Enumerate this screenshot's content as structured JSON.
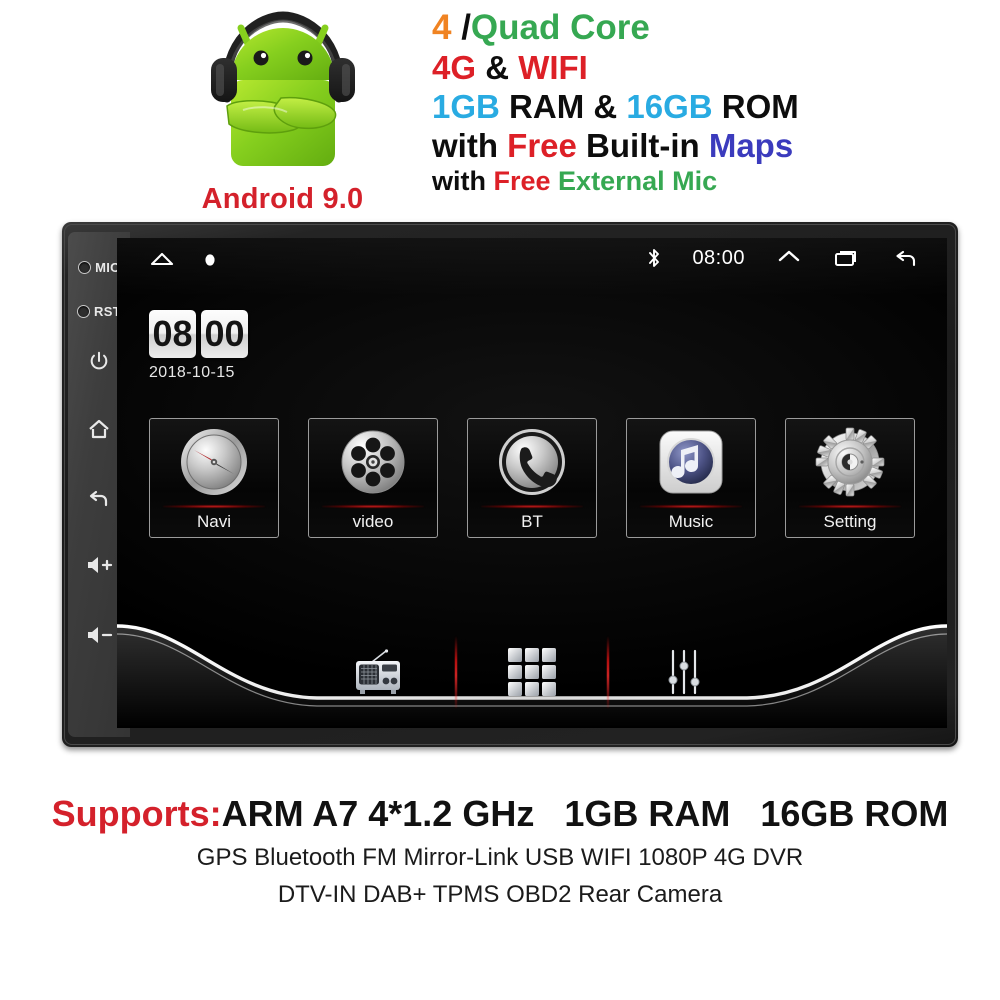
{
  "header": {
    "android": {
      "logo_icon": "android-robot-with-headphones-icon",
      "label": "Android 9.0",
      "label_color": "#d4212b"
    },
    "spec_lines": [
      {
        "id": "cpu",
        "parts": [
          {
            "text": "4",
            "color": "#f08322"
          },
          {
            "text": " /",
            "color": "#0d0d0d"
          },
          {
            "text": "Quad Core",
            "color": "#36a852"
          }
        ]
      },
      {
        "id": "connectivity",
        "parts": [
          {
            "text": "4G",
            "color": "#dd2027"
          },
          {
            "text": " & ",
            "color": "#0d0d0d"
          },
          {
            "text": "WIFI",
            "color": "#dd2027"
          }
        ]
      },
      {
        "id": "memory",
        "parts": [
          {
            "text": "1GB",
            "color": "#29abe2"
          },
          {
            "text": " RAM & ",
            "color": "#0d0d0d"
          },
          {
            "text": "16GB",
            "color": "#29abe2"
          },
          {
            "text": " ROM",
            "color": "#0d0d0d"
          }
        ]
      },
      {
        "id": "maps",
        "parts": [
          {
            "text": "with ",
            "color": "#0d0d0d"
          },
          {
            "text": "Free",
            "color": "#dd2027"
          },
          {
            "text": " Built-in ",
            "color": "#0d0d0d"
          },
          {
            "text": "Maps",
            "color": "#3b3bbd"
          }
        ]
      },
      {
        "id": "mic",
        "parts": [
          {
            "text": "with ",
            "color": "#0d0d0d"
          },
          {
            "text": "Free",
            "color": "#dd2027"
          },
          {
            "text": " External Mic",
            "color": "#36a852"
          }
        ]
      }
    ]
  },
  "device": {
    "side_buttons": [
      {
        "name": "mic-hole",
        "label": "MIC",
        "type": "hole"
      },
      {
        "name": "reset-hole",
        "label": "RST",
        "type": "hole"
      },
      {
        "name": "power-button",
        "label": "⏻",
        "type": "icon"
      },
      {
        "name": "home-button",
        "label": "⌂",
        "type": "icon"
      },
      {
        "name": "back-button",
        "label": "↩",
        "type": "icon"
      },
      {
        "name": "volume-up-button",
        "label": "🔊+",
        "type": "icon"
      },
      {
        "name": "volume-down-button",
        "label": "🔊−",
        "type": "icon"
      }
    ],
    "screen": {
      "statusbar": {
        "left_icons": [
          {
            "name": "home-icon",
            "glyph": "home"
          },
          {
            "name": "dot-indicator-icon",
            "glyph": "dot"
          }
        ],
        "bluetooth_icon": "bluetooth-icon",
        "time": "08:00",
        "right_icons": [
          {
            "name": "expand-up-icon",
            "glyph": "chevron-up"
          },
          {
            "name": "recents-icon",
            "glyph": "recents"
          },
          {
            "name": "back-icon",
            "glyph": "back-arrow"
          }
        ]
      },
      "clock_widget": {
        "hours": "08",
        "minutes": "00",
        "date": "2018-10-15"
      },
      "apps": [
        {
          "name": "app-navi",
          "label": "Navi",
          "icon": "compass-icon"
        },
        {
          "name": "app-video",
          "label": "video",
          "icon": "film-reel-icon"
        },
        {
          "name": "app-bt",
          "label": "BT",
          "icon": "phone-handset-icon"
        },
        {
          "name": "app-music",
          "label": "Music",
          "icon": "music-note-icon"
        },
        {
          "name": "app-setting",
          "label": "Setting",
          "icon": "gear-icon"
        }
      ],
      "dock": [
        {
          "name": "dock-radio",
          "icon": "radio-icon"
        },
        {
          "name": "dock-all-apps",
          "icon": "app-grid-icon"
        },
        {
          "name": "dock-equalizer",
          "icon": "equalizer-sliders-icon"
        }
      ],
      "accent_red": "#e61414"
    }
  },
  "footer": {
    "supports_label": "Supports:",
    "supports_label_color": "#d4212b",
    "main_specs": "ARM A7 4*1.2 GHz   1GB RAM   16GB ROM",
    "features_row1": "GPS  Bluetooth  FM  Mirror-Link  USB  WIFI  1080P  4G  DVR",
    "features_row2": "DTV-IN   DAB+   TPMS   OBD2   Rear Camera"
  }
}
